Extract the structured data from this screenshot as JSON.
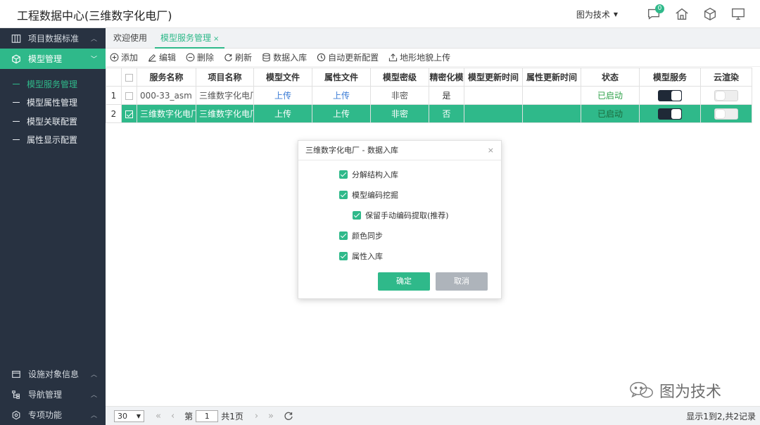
{
  "header": {
    "title": "工程数据中心(三维数字化电厂)",
    "user": "图为技术",
    "notification_count": "0"
  },
  "sidebar": {
    "groups_top": [
      {
        "label": "项目数据标准",
        "icon": "columns-icon"
      },
      {
        "label": "模型管理",
        "icon": "cube-icon",
        "active": true
      }
    ],
    "items": [
      {
        "label": "模型服务管理",
        "active": true
      },
      {
        "label": "模型属性管理"
      },
      {
        "label": "模型关联配置"
      },
      {
        "label": "属性显示配置"
      }
    ],
    "groups_bottom": [
      {
        "label": "设施对象信息",
        "icon": "window-icon"
      },
      {
        "label": "导航管理",
        "icon": "tree-icon"
      },
      {
        "label": "专项功能",
        "icon": "gear-icon"
      }
    ]
  },
  "tabs": [
    {
      "label": "欢迎使用"
    },
    {
      "label": "模型服务管理",
      "active": true
    }
  ],
  "toolbar": {
    "add": "添加",
    "edit": "编辑",
    "delete": "删除",
    "refresh": "刷新",
    "import": "数据入库",
    "auto_update": "自动更新配置",
    "terrain_upload": "地形地貌上传"
  },
  "table": {
    "columns": [
      "服务名称",
      "项目名称",
      "模型文件",
      "属性文件",
      "模型密级",
      "精密化模",
      "模型更新时间",
      "属性更新时间",
      "状态",
      "模型服务",
      "云渲染"
    ],
    "rows": [
      {
        "num": "1",
        "service": "000-33_asm",
        "project": "三维数字化电厂",
        "model_file": "上传",
        "attr_file": "上传",
        "level": "非密",
        "precise": "是",
        "model_time": "",
        "attr_time": "",
        "status": "已启动",
        "service_on": true,
        "cloud_on": false,
        "selected": false
      },
      {
        "num": "2",
        "service": "三维数字化电厂",
        "project": "三维数字化电厂",
        "model_file": "上传",
        "attr_file": "上传",
        "level": "非密",
        "precise": "否",
        "model_time": "",
        "attr_time": "",
        "status": "已启动",
        "service_on": true,
        "cloud_on": false,
        "selected": true
      }
    ]
  },
  "dialog": {
    "title": "三维数字化电厂 - 数据入库",
    "close": "×",
    "options": [
      "分解结构入库",
      "模型编码挖掘",
      "保留手动编码提取(推荐)",
      "颜色同步",
      "属性入库"
    ],
    "ok": "确定",
    "cancel": "取消"
  },
  "pager": {
    "page_size": "30",
    "page_label": "第",
    "page": "1",
    "total_pages": "共1页",
    "info": "显示1到2,共2记录"
  },
  "watermark": {
    "text": "图为技术"
  },
  "colors": {
    "accent": "#2fb98a",
    "sidebar": "#283241"
  }
}
